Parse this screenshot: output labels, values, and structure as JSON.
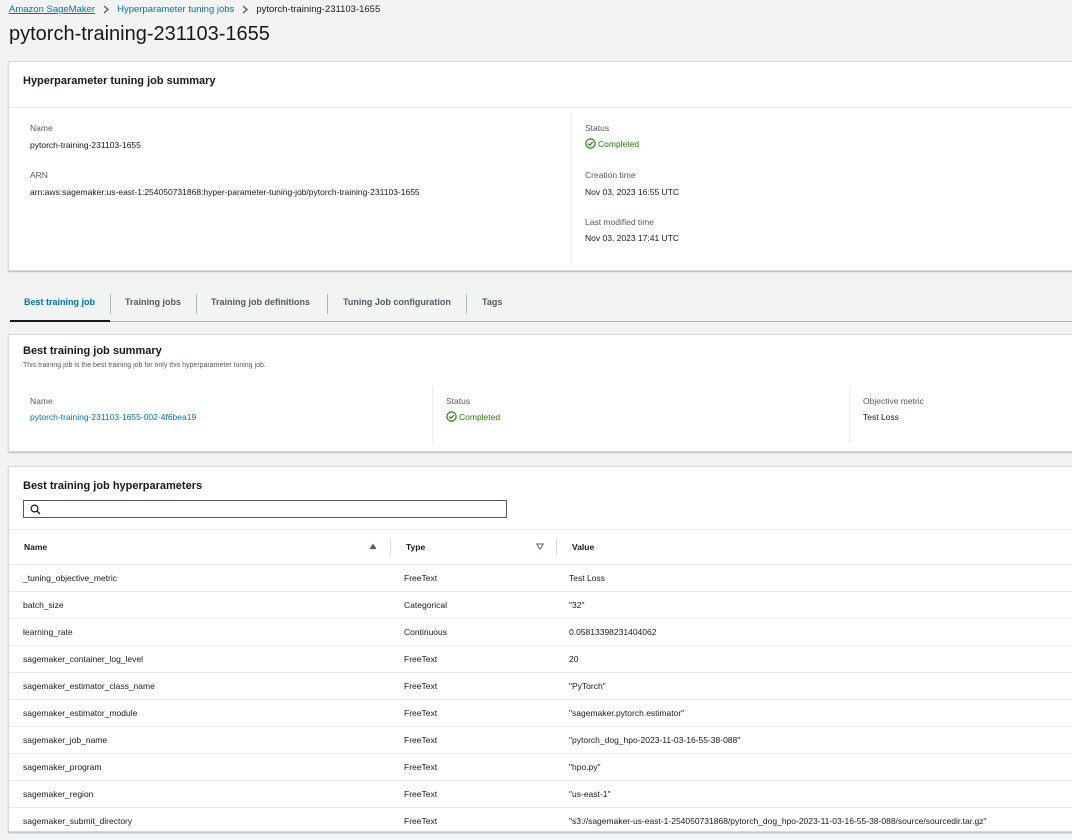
{
  "breadcrumb": {
    "items": [
      "Amazon SageMaker",
      "Hyperparameter tuning jobs",
      "pytorch-training-231103-1655"
    ]
  },
  "page_title": "pytorch-training-231103-1655",
  "summary": {
    "title": "Hyperparameter tuning job summary",
    "name_label": "Name",
    "name_value": "pytorch-training-231103-1655",
    "arn_label": "ARN",
    "arn_value": "arn:aws:sagemaker:us-east-1:254050731868:hyper-parameter-tuning-job/pytorch-training-231103-1655",
    "status_label": "Status",
    "status_value": "Completed",
    "creation_label": "Creation time",
    "creation_value": "Nov 03, 2023 16:55 UTC",
    "modified_label": "Last modified time",
    "modified_value": "Nov 03, 2023 17:41 UTC"
  },
  "tabs": [
    "Best training job",
    "Training jobs",
    "Training job definitions",
    "Tuning Job configuration",
    "Tags"
  ],
  "best_summary": {
    "title": "Best training job summary",
    "description": "This training job is the best training job for only this hyperparameter tuning job.",
    "name_label": "Name",
    "name_value": "pytorch-training-231103-1655-002-4f6bea19",
    "status_label": "Status",
    "status_value": "Completed",
    "objective_label": "Objective metric",
    "objective_value": "Test Loss"
  },
  "hyperparameters": {
    "title": "Best training job hyperparameters",
    "search_placeholder": "",
    "columns": [
      "Name",
      "Type",
      "Value"
    ],
    "rows": [
      [
        "_tuning_objective_metric",
        "FreeText",
        "Test Loss"
      ],
      [
        "batch_size",
        "Categorical",
        "\"32\""
      ],
      [
        "learning_rate",
        "Continuous",
        "0.05813398231404062"
      ],
      [
        "sagemaker_container_log_level",
        "FreeText",
        "20"
      ],
      [
        "sagemaker_estimator_class_name",
        "FreeText",
        "\"PyTorch\""
      ],
      [
        "sagemaker_estimator_module",
        "FreeText",
        "\"sagemaker.pytorch.estimator\""
      ],
      [
        "sagemaker_job_name",
        "FreeText",
        "\"pytorch_dog_hpo-2023-11-03-16-55-38-088\""
      ],
      [
        "sagemaker_program",
        "FreeText",
        "\"hpo.py\""
      ],
      [
        "sagemaker_region",
        "FreeText",
        "\"us-east-1\""
      ],
      [
        "sagemaker_submit_directory",
        "FreeText",
        "\"s3://sagemaker-us-east-1-254050731868/pytorch_dog_hpo-2023-11-03-16-55-38-088/source/sourcedir.tar.gz\""
      ]
    ]
  },
  "colors": {
    "link": "#0073bb",
    "success": "#1d8102",
    "background": "#f2f3f3"
  }
}
